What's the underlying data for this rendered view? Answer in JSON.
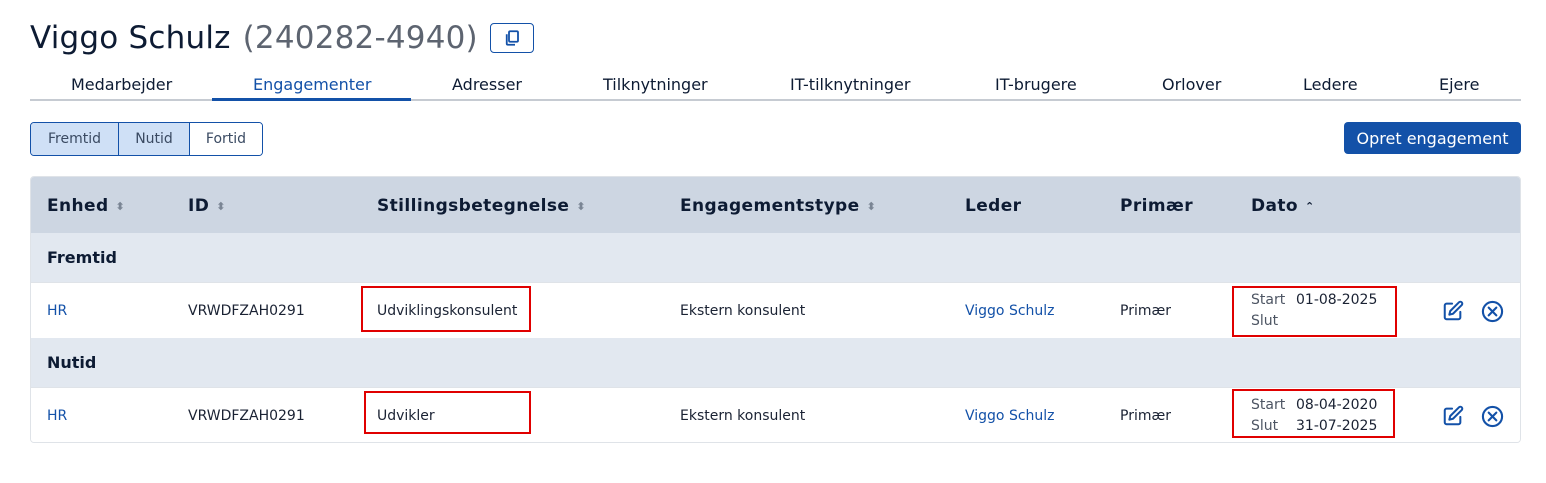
{
  "person": {
    "name": "Viggo Schulz",
    "cpr": "(240282-4940)"
  },
  "tabs": [
    "Medarbejder",
    "Engagementer",
    "Adresser",
    "Tilknytninger",
    "IT-tilknytninger",
    "IT-brugere",
    "Orlover",
    "Ledere",
    "Ejere"
  ],
  "active_tab": "Engagementer",
  "filters": [
    {
      "label": "Fremtid",
      "selected": true
    },
    {
      "label": "Nutid",
      "selected": true
    },
    {
      "label": "Fortid",
      "selected": false
    }
  ],
  "create_button": "Opret engagement",
  "table": {
    "columns": [
      "Enhed",
      "ID",
      "Stillingsbetegnelse",
      "Engagementstype",
      "Leder",
      "Primær",
      "Dato"
    ],
    "date_labels": {
      "start": "Start",
      "end": "Slut"
    },
    "groups": [
      {
        "label": "Fremtid",
        "rows": [
          {
            "unit": "HR",
            "id": "VRWDFZAH0291",
            "title": "Udviklingskonsulent",
            "type": "Ekstern konsulent",
            "manager": "Viggo Schulz",
            "primary": "Primær",
            "start": "01-08-2025",
            "end": ""
          }
        ]
      },
      {
        "label": "Nutid",
        "rows": [
          {
            "unit": "HR",
            "id": "VRWDFZAH0291",
            "title": "Udvikler",
            "type": "Ekstern konsulent",
            "manager": "Viggo Schulz",
            "primary": "Primær",
            "start": "08-04-2020",
            "end": "31-07-2025"
          }
        ]
      }
    ]
  },
  "icons": {
    "copy": "copy-icon",
    "edit": "edit-icon",
    "delete": "circle-x-icon"
  },
  "colors": {
    "primary": "#1351a8",
    "highlight": "#e00000",
    "header_bg": "#cdd6e2",
    "group_bg": "#e2e8f0"
  }
}
